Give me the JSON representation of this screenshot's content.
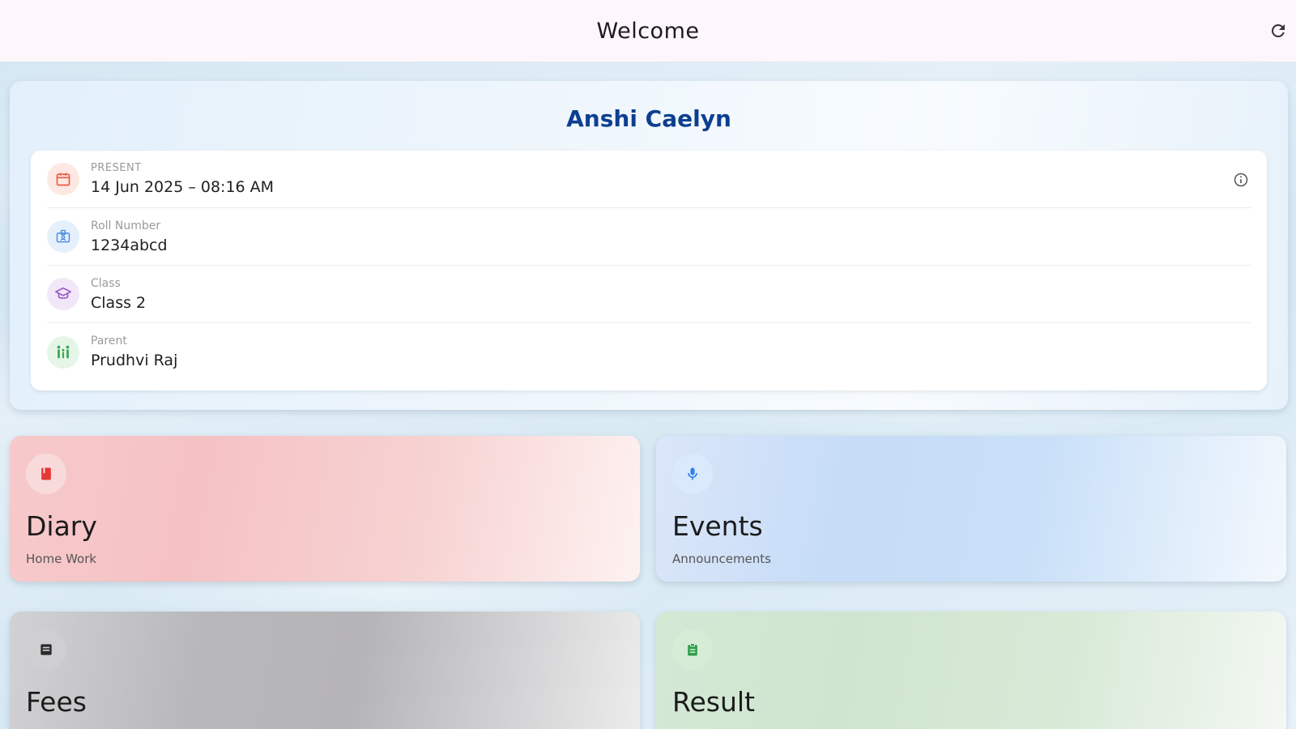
{
  "appbar": {
    "title": "Welcome",
    "refresh_icon": "refresh-icon"
  },
  "profile": {
    "name": "Anshi Caelyn",
    "rows": [
      {
        "label": "PRESENT",
        "value": "14 Jun 2025 – 08:16 AM",
        "icon": "calendar-icon",
        "color": "#ef5a3c",
        "bg": "#fde8e4"
      },
      {
        "label": "Roll Number",
        "value": "1234abcd",
        "icon": "badge-icon",
        "color": "#4a90e2",
        "bg": "#e6f0fc"
      },
      {
        "label": "Class",
        "value": "Class 2",
        "icon": "graduation-cap-icon",
        "color": "#9b59c6",
        "bg": "#f2e7f9"
      },
      {
        "label": "Parent",
        "value": "Prudhvi Raj",
        "icon": "family-icon",
        "color": "#3aa655",
        "bg": "#e5f5e8"
      }
    ],
    "info_icon": "info-icon"
  },
  "tiles": [
    {
      "title": "Diary",
      "subtitle": "Home Work",
      "icon": "book-icon",
      "icon_color": "#e53935",
      "icon_bg": "#f9dada"
    },
    {
      "title": "Events",
      "subtitle": "Announcements",
      "icon": "microphone-icon",
      "icon_color": "#2f80ed",
      "icon_bg": "#dae9fb"
    },
    {
      "title": "Fees",
      "subtitle": "",
      "icon": "receipt-icon",
      "icon_color": "#2b2b2b",
      "icon_bg": "#cfced1"
    },
    {
      "title": "Result",
      "subtitle": "",
      "icon": "clipboard-icon",
      "icon_color": "#2e9e4a",
      "icon_bg": "#d7ecd7"
    }
  ]
}
